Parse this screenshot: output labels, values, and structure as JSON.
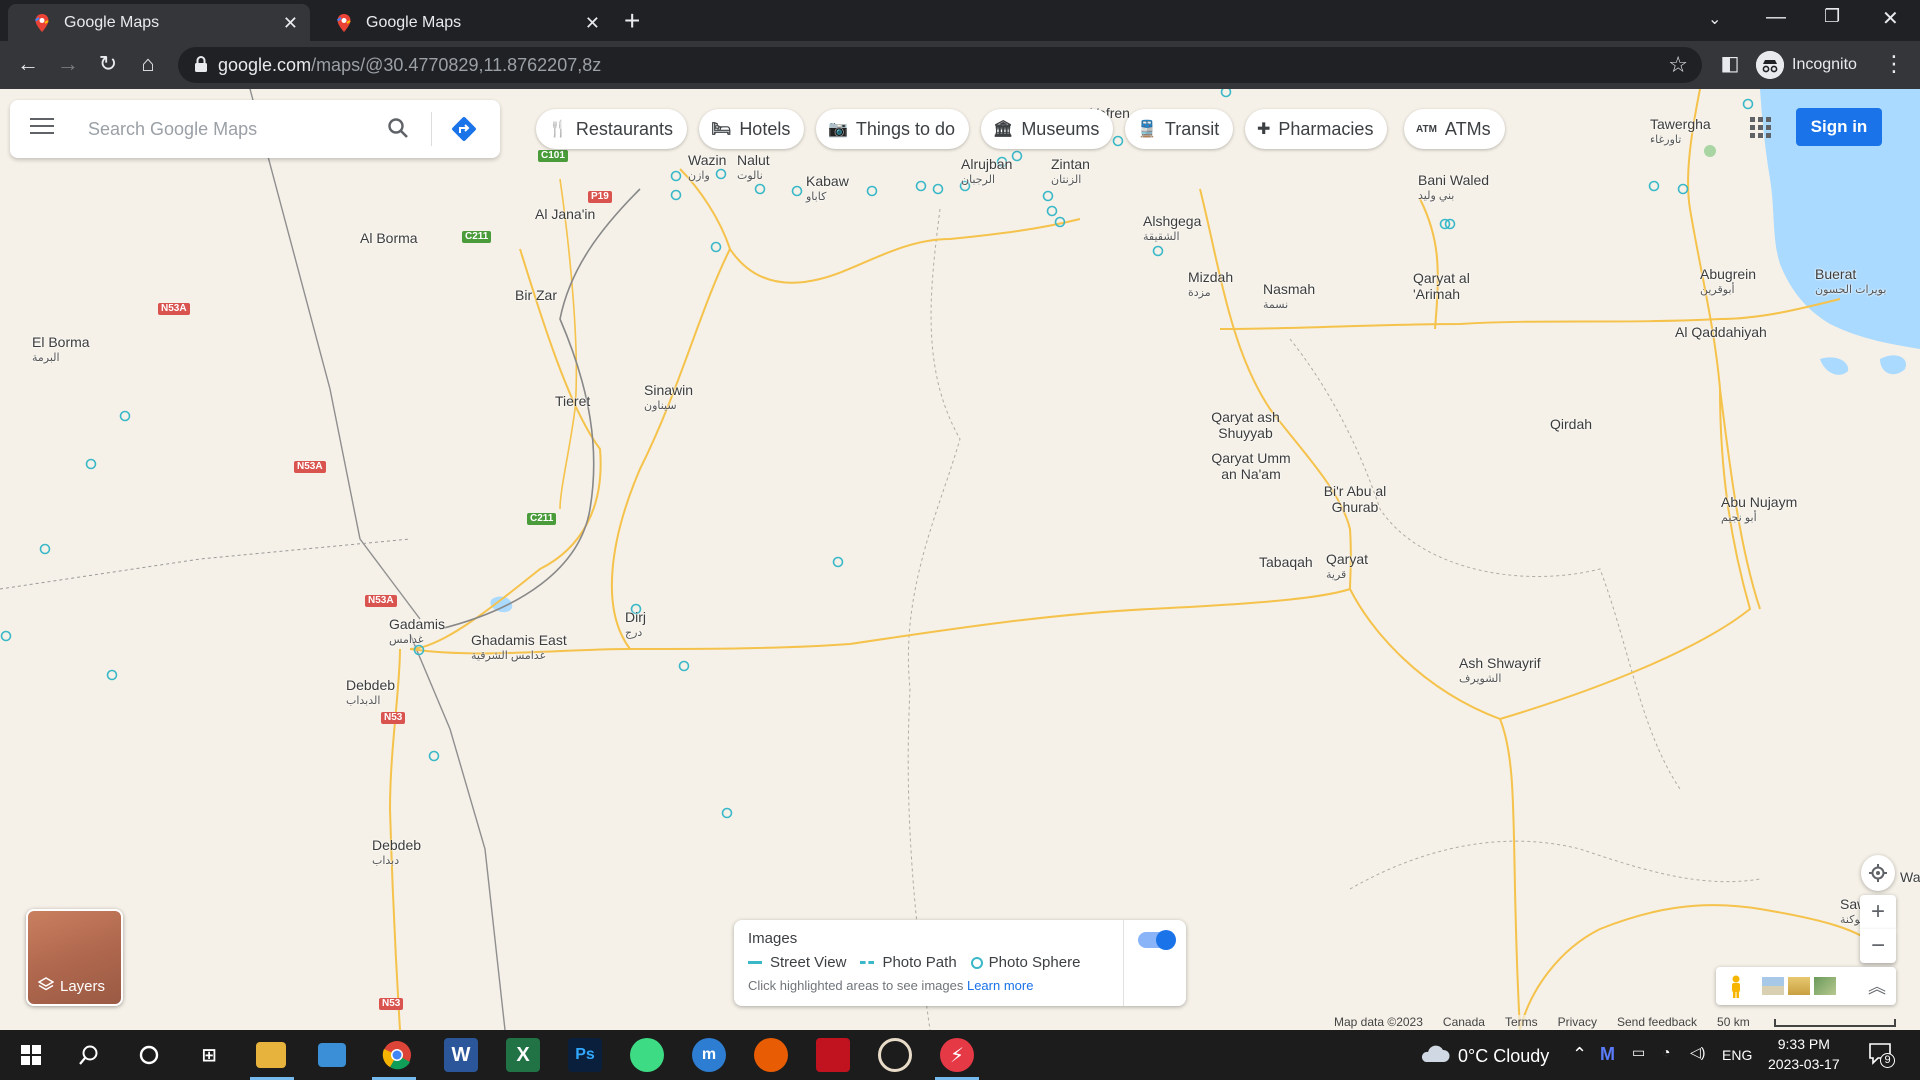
{
  "browser": {
    "tabs": [
      {
        "title": "Google Maps",
        "active": true
      },
      {
        "title": "Google Maps",
        "active": false
      }
    ],
    "new_tab": "+",
    "url_host": "google.com",
    "url_path": "/maps/@30.4770829,11.8762207,8z",
    "profile_label": "Incognito"
  },
  "maps": {
    "search_placeholder": "Search Google Maps",
    "chips": [
      {
        "label": "Restaurants",
        "icon": "restaurant-icon",
        "glyph": "🍴"
      },
      {
        "label": "Hotels",
        "icon": "hotel-icon",
        "glyph": "🛏"
      },
      {
        "label": "Things to do",
        "icon": "camera-icon",
        "glyph": "📷"
      },
      {
        "label": "Museums",
        "icon": "museum-icon",
        "glyph": "🏛"
      },
      {
        "label": "Transit",
        "icon": "train-icon",
        "glyph": "🚆"
      },
      {
        "label": "Pharmacies",
        "icon": "pharmacy-icon",
        "glyph": "✚"
      },
      {
        "label": "ATMs",
        "icon": "atm-icon",
        "glyph": "ATM"
      }
    ],
    "sign_in": "Sign in",
    "layers_label": "Layers",
    "images_panel": {
      "title": "Images",
      "legend": [
        "Street View",
        "Photo Path",
        "Photo Sphere"
      ],
      "note": "Click highlighted areas to see images",
      "learn_more": "Learn more",
      "toggle_on": true
    },
    "attribution": [
      "Map data ©2023",
      "Canada",
      "Terms",
      "Privacy",
      "Send feedback",
      "50 km"
    ],
    "places": [
      {
        "name": "Wazin",
        "ar": "وازن"
      },
      {
        "name": "Nalut",
        "ar": "نالوت"
      },
      {
        "name": "Kabaw",
        "ar": "كاباو"
      },
      {
        "name": "Alrujban",
        "ar": "الرجبان"
      },
      {
        "name": "Zintan",
        "ar": "الزنتان"
      },
      {
        "name": "Yefren",
        "ar": ""
      },
      {
        "name": "Tawergha",
        "ar": "تاورغاء"
      },
      {
        "name": "Al Jana'in",
        "ar": ""
      },
      {
        "name": "Al Borma",
        "ar": ""
      },
      {
        "name": "Bani Waled",
        "ar": "بني وليد"
      },
      {
        "name": "Alshgega",
        "ar": "الشقيقة"
      },
      {
        "name": "Mizdah",
        "ar": "مزدة"
      },
      {
        "name": "Nasmah",
        "ar": "نسمة"
      },
      {
        "name": "Qaryat al 'Arimah",
        "ar": ""
      },
      {
        "name": "Abugrein",
        "ar": "أبوقرين"
      },
      {
        "name": "Buerat",
        "ar": "بويرات الحسون"
      },
      {
        "name": "Al Qaddahiyah",
        "ar": ""
      },
      {
        "name": "El Borma",
        "ar": "البرمة"
      },
      {
        "name": "Bir Zar",
        "ar": ""
      },
      {
        "name": "Sinawin",
        "ar": "سيناون"
      },
      {
        "name": "Tieret",
        "ar": ""
      },
      {
        "name": "Qaryat ash Shuyyab",
        "ar": ""
      },
      {
        "name": "Qaryat Umm an Na'am",
        "ar": ""
      },
      {
        "name": "Qirdah",
        "ar": ""
      },
      {
        "name": "Bi'r Abu al Ghurab",
        "ar": ""
      },
      {
        "name": "Abu Nujaym",
        "ar": "أبو نجيم"
      },
      {
        "name": "Tabaqah",
        "ar": ""
      },
      {
        "name": "Qaryat",
        "ar": "قرية"
      },
      {
        "name": "Dirj",
        "ar": "درج"
      },
      {
        "name": "Gadamis",
        "ar": "غدامس"
      },
      {
        "name": "Ghadamis East",
        "ar": "غدامس الشرقية"
      },
      {
        "name": "Debdeb",
        "ar": "الدبداب"
      },
      {
        "name": "Ash Shwayrif",
        "ar": "الشويرف"
      },
      {
        "name": "Debdeb",
        "ar": "دبداب"
      },
      {
        "name": "Sawk",
        "ar": "سوكنة"
      },
      {
        "name": "Wa",
        "ar": ""
      }
    ],
    "road_shields": [
      {
        "label": "C101",
        "color": "green"
      },
      {
        "label": "P19",
        "color": "red"
      },
      {
        "label": "C211",
        "color": "green"
      },
      {
        "label": "N53A",
        "color": "red"
      },
      {
        "label": "N53A",
        "color": "red"
      },
      {
        "label": "C211",
        "color": "green"
      },
      {
        "label": "N53A",
        "color": "red"
      },
      {
        "label": "N53",
        "color": "red"
      },
      {
        "label": "N53",
        "color": "red"
      }
    ]
  },
  "taskbar": {
    "weather": "0°C  Cloudy",
    "language": "ENG",
    "time": "9:33 PM",
    "date": "2023-03-17",
    "notification_count": "9"
  }
}
